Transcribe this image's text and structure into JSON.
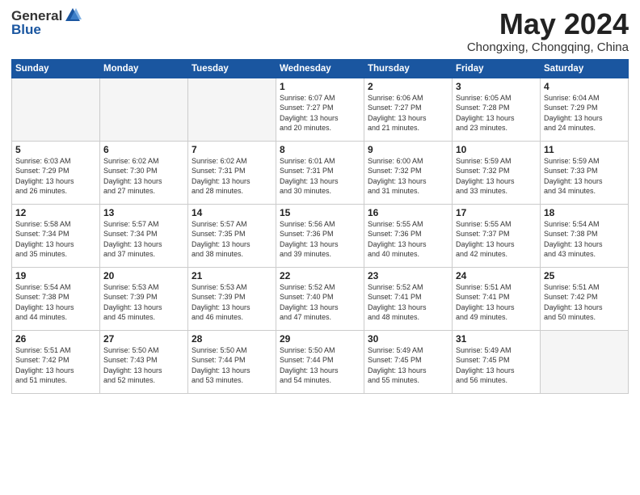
{
  "logo": {
    "general": "General",
    "blue": "Blue"
  },
  "header": {
    "month_year": "May 2024",
    "location": "Chongxing, Chongqing, China"
  },
  "weekdays": [
    "Sunday",
    "Monday",
    "Tuesday",
    "Wednesday",
    "Thursday",
    "Friday",
    "Saturday"
  ],
  "weeks": [
    [
      {
        "day": "",
        "info": ""
      },
      {
        "day": "",
        "info": ""
      },
      {
        "day": "",
        "info": ""
      },
      {
        "day": "1",
        "info": "Sunrise: 6:07 AM\nSunset: 7:27 PM\nDaylight: 13 hours\nand 20 minutes."
      },
      {
        "day": "2",
        "info": "Sunrise: 6:06 AM\nSunset: 7:27 PM\nDaylight: 13 hours\nand 21 minutes."
      },
      {
        "day": "3",
        "info": "Sunrise: 6:05 AM\nSunset: 7:28 PM\nDaylight: 13 hours\nand 23 minutes."
      },
      {
        "day": "4",
        "info": "Sunrise: 6:04 AM\nSunset: 7:29 PM\nDaylight: 13 hours\nand 24 minutes."
      }
    ],
    [
      {
        "day": "5",
        "info": "Sunrise: 6:03 AM\nSunset: 7:29 PM\nDaylight: 13 hours\nand 26 minutes."
      },
      {
        "day": "6",
        "info": "Sunrise: 6:02 AM\nSunset: 7:30 PM\nDaylight: 13 hours\nand 27 minutes."
      },
      {
        "day": "7",
        "info": "Sunrise: 6:02 AM\nSunset: 7:31 PM\nDaylight: 13 hours\nand 28 minutes."
      },
      {
        "day": "8",
        "info": "Sunrise: 6:01 AM\nSunset: 7:31 PM\nDaylight: 13 hours\nand 30 minutes."
      },
      {
        "day": "9",
        "info": "Sunrise: 6:00 AM\nSunset: 7:32 PM\nDaylight: 13 hours\nand 31 minutes."
      },
      {
        "day": "10",
        "info": "Sunrise: 5:59 AM\nSunset: 7:32 PM\nDaylight: 13 hours\nand 33 minutes."
      },
      {
        "day": "11",
        "info": "Sunrise: 5:59 AM\nSunset: 7:33 PM\nDaylight: 13 hours\nand 34 minutes."
      }
    ],
    [
      {
        "day": "12",
        "info": "Sunrise: 5:58 AM\nSunset: 7:34 PM\nDaylight: 13 hours\nand 35 minutes."
      },
      {
        "day": "13",
        "info": "Sunrise: 5:57 AM\nSunset: 7:34 PM\nDaylight: 13 hours\nand 37 minutes."
      },
      {
        "day": "14",
        "info": "Sunrise: 5:57 AM\nSunset: 7:35 PM\nDaylight: 13 hours\nand 38 minutes."
      },
      {
        "day": "15",
        "info": "Sunrise: 5:56 AM\nSunset: 7:36 PM\nDaylight: 13 hours\nand 39 minutes."
      },
      {
        "day": "16",
        "info": "Sunrise: 5:55 AM\nSunset: 7:36 PM\nDaylight: 13 hours\nand 40 minutes."
      },
      {
        "day": "17",
        "info": "Sunrise: 5:55 AM\nSunset: 7:37 PM\nDaylight: 13 hours\nand 42 minutes."
      },
      {
        "day": "18",
        "info": "Sunrise: 5:54 AM\nSunset: 7:38 PM\nDaylight: 13 hours\nand 43 minutes."
      }
    ],
    [
      {
        "day": "19",
        "info": "Sunrise: 5:54 AM\nSunset: 7:38 PM\nDaylight: 13 hours\nand 44 minutes."
      },
      {
        "day": "20",
        "info": "Sunrise: 5:53 AM\nSunset: 7:39 PM\nDaylight: 13 hours\nand 45 minutes."
      },
      {
        "day": "21",
        "info": "Sunrise: 5:53 AM\nSunset: 7:39 PM\nDaylight: 13 hours\nand 46 minutes."
      },
      {
        "day": "22",
        "info": "Sunrise: 5:52 AM\nSunset: 7:40 PM\nDaylight: 13 hours\nand 47 minutes."
      },
      {
        "day": "23",
        "info": "Sunrise: 5:52 AM\nSunset: 7:41 PM\nDaylight: 13 hours\nand 48 minutes."
      },
      {
        "day": "24",
        "info": "Sunrise: 5:51 AM\nSunset: 7:41 PM\nDaylight: 13 hours\nand 49 minutes."
      },
      {
        "day": "25",
        "info": "Sunrise: 5:51 AM\nSunset: 7:42 PM\nDaylight: 13 hours\nand 50 minutes."
      }
    ],
    [
      {
        "day": "26",
        "info": "Sunrise: 5:51 AM\nSunset: 7:42 PM\nDaylight: 13 hours\nand 51 minutes."
      },
      {
        "day": "27",
        "info": "Sunrise: 5:50 AM\nSunset: 7:43 PM\nDaylight: 13 hours\nand 52 minutes."
      },
      {
        "day": "28",
        "info": "Sunrise: 5:50 AM\nSunset: 7:44 PM\nDaylight: 13 hours\nand 53 minutes."
      },
      {
        "day": "29",
        "info": "Sunrise: 5:50 AM\nSunset: 7:44 PM\nDaylight: 13 hours\nand 54 minutes."
      },
      {
        "day": "30",
        "info": "Sunrise: 5:49 AM\nSunset: 7:45 PM\nDaylight: 13 hours\nand 55 minutes."
      },
      {
        "day": "31",
        "info": "Sunrise: 5:49 AM\nSunset: 7:45 PM\nDaylight: 13 hours\nand 56 minutes."
      },
      {
        "day": "",
        "info": ""
      }
    ]
  ]
}
